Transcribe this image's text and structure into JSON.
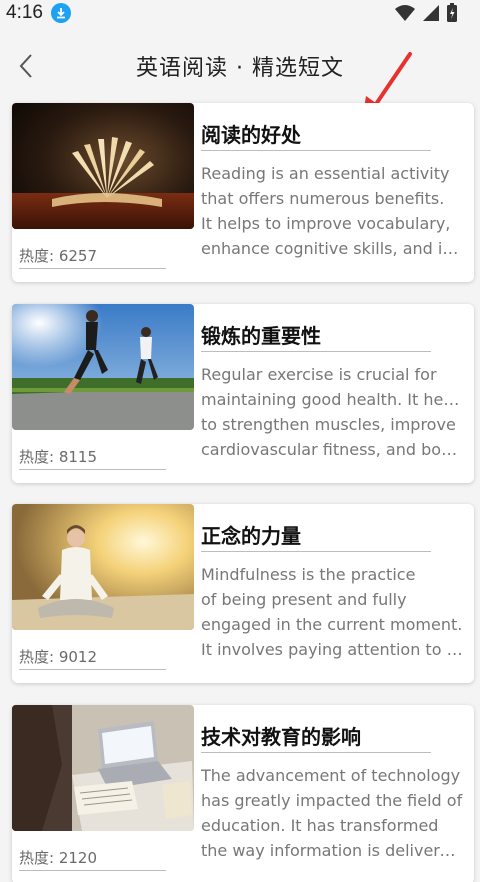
{
  "status_bar": {
    "time": "4:16"
  },
  "header": {
    "title": "英语阅读 · 精选短文"
  },
  "articles": [
    {
      "title": "阅读的好处",
      "heat": "热度: 6257",
      "lines": [
        "Reading is an essential activity",
        "that offers numerous benefits.",
        "It helps to improve vocabulary,",
        "enhance cognitive skills, and incr..."
      ]
    },
    {
      "title": "锻炼的重要性",
      "heat": "热度: 8115",
      "lines": [
        "Regular exercise is crucial for",
        "maintaining good health. It helps",
        "to strengthen muscles, improve",
        "cardiovascular fitness, and boos..."
      ]
    },
    {
      "title": "正念的力量",
      "heat": "热度: 9012",
      "lines": [
        "Mindfulness is the practice",
        "of being present and fully",
        "engaged in the current moment.",
        "It involves paying attention to th..."
      ]
    },
    {
      "title": "技术对教育的影响",
      "heat": "热度: 2120",
      "lines": [
        "The advancement of technology",
        "has greatly impacted the field of",
        "education. It has transformed",
        "the way information is delivered ..."
      ]
    }
  ]
}
